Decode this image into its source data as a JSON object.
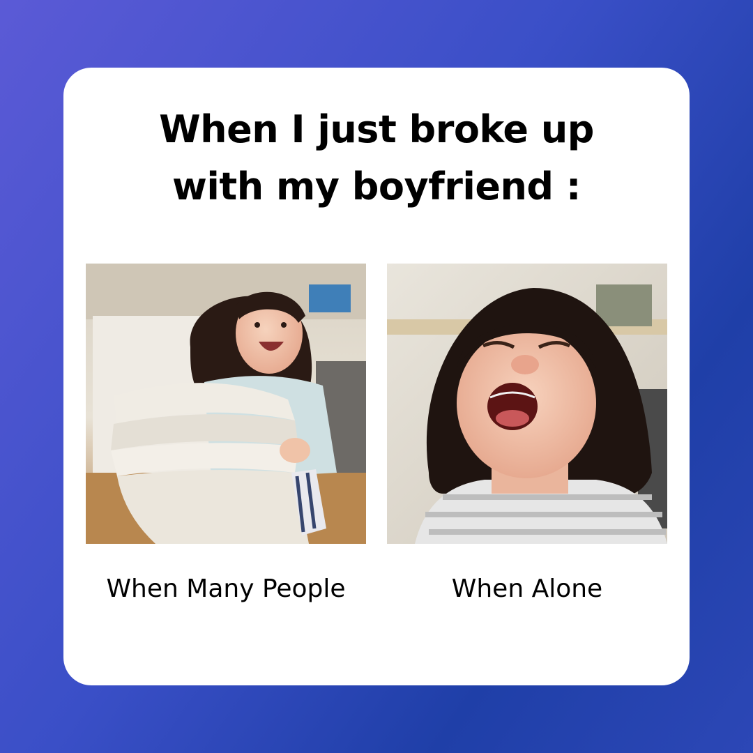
{
  "card": {
    "title_line_1": "When I just broke up",
    "title_line_2": "with my boyfriend :"
  },
  "panels": [
    {
      "caption": "When Many People",
      "image": "laughing-girl-with-towels-photo"
    },
    {
      "caption": "When Alone",
      "image": "crying-girl-photo"
    }
  ],
  "colors": {
    "background_start": "#5b5ad6",
    "background_end": "#1f3fa8",
    "card": "#ffffff",
    "text": "#000000"
  }
}
